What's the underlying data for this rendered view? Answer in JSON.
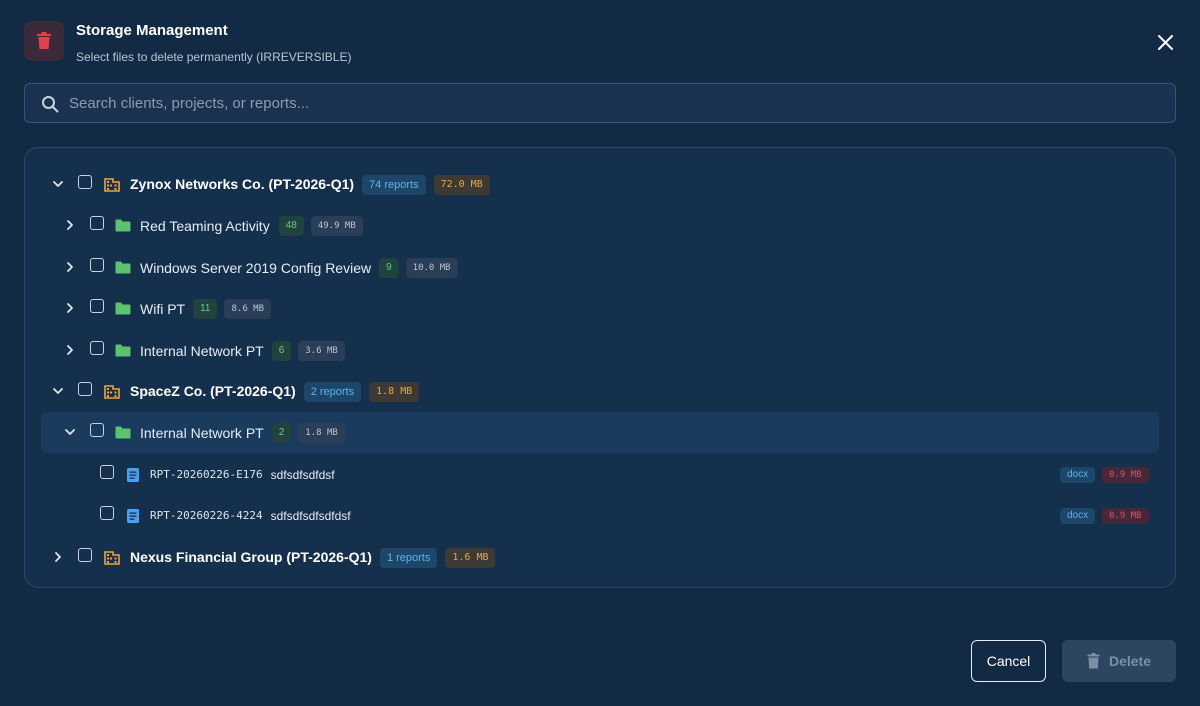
{
  "dialog": {
    "title": "Storage Management",
    "subtitle": "Select files to delete permanently (IRREVERSIBLE)",
    "icon": "trash-icon",
    "close_icon": "close-icon"
  },
  "search": {
    "placeholder": "Search clients, projects, or reports...",
    "value": ""
  },
  "tree": {
    "clients": [
      {
        "name": "Zynox Networks Co. (PT-2026-Q1)",
        "reports_label": "74 reports",
        "size": "72.0 MB",
        "expanded": true,
        "projects": [
          {
            "name": "Red Teaming Activity",
            "count": "48",
            "size": "49.9 MB",
            "expanded": false
          },
          {
            "name": "Windows Server 2019 Config Review",
            "count": "9",
            "size": "10.0 MB",
            "expanded": false
          },
          {
            "name": "Wifi PT",
            "count": "11",
            "size": "8.6 MB",
            "expanded": false
          },
          {
            "name": "Internal Network PT",
            "count": "6",
            "size": "3.6 MB",
            "expanded": false
          }
        ]
      },
      {
        "name": "SpaceZ Co. (PT-2026-Q1)",
        "reports_label": "2 reports",
        "size": "1.8 MB",
        "expanded": true,
        "projects": [
          {
            "name": "Internal Network PT",
            "count": "2",
            "size": "1.8 MB",
            "expanded": true,
            "reports": [
              {
                "id": "RPT-20260226-E176",
                "name": "sdfsdfsdfdsf",
                "type": "docx",
                "size": "0.9 MB"
              },
              {
                "id": "RPT-20260226-4224",
                "name": "sdfsdfsdfsdfdsf",
                "type": "docx",
                "size": "0.9 MB"
              }
            ]
          }
        ]
      },
      {
        "name": "Nexus Financial Group (PT-2026-Q1)",
        "reports_label": "1 reports",
        "size": "1.6 MB",
        "expanded": false,
        "projects": []
      }
    ]
  },
  "footer": {
    "cancel_label": "Cancel",
    "delete_label": "Delete"
  },
  "colors": {
    "background": "#132a45",
    "client_icon": "#f0a43a",
    "folder_icon": "#5cc26e",
    "file_icon": "#4a9ff0",
    "danger": "#e0505a"
  }
}
